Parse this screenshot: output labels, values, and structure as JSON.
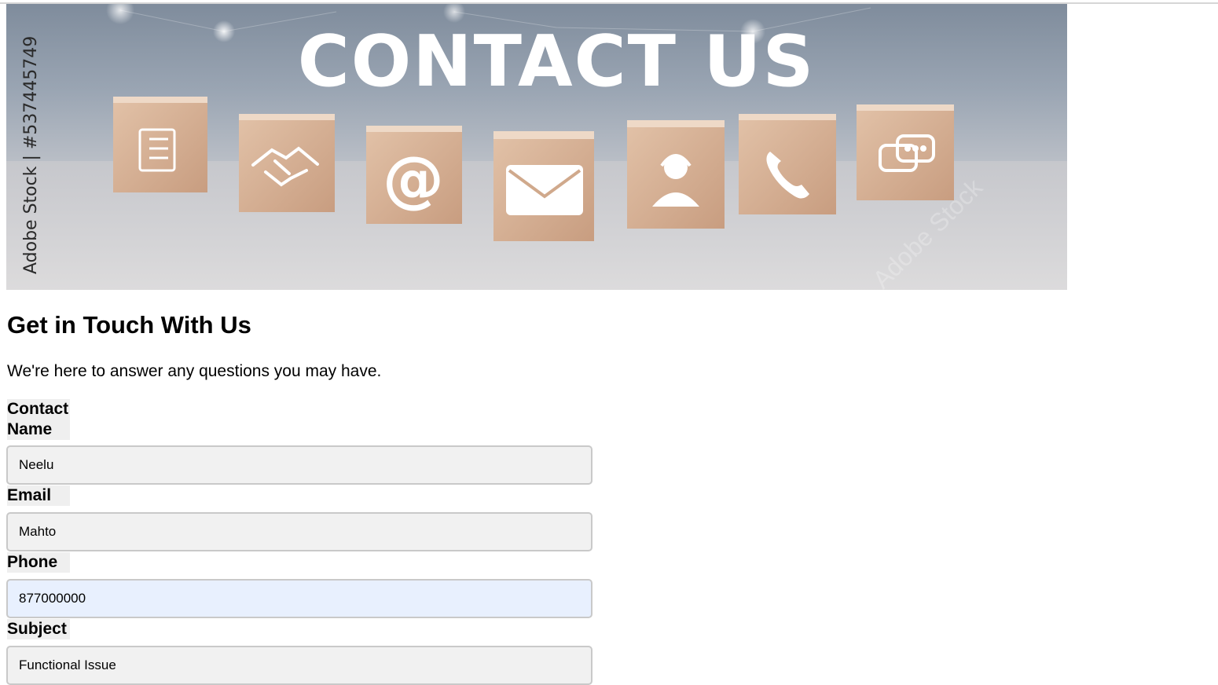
{
  "hero": {
    "title": "CONTACT US",
    "watermark": "Adobe Stock | #537445749",
    "stock_mark": "Adobe Stock",
    "cube_icons": [
      "checklist-icon",
      "handshake-icon",
      "at-sign-icon",
      "envelope-icon",
      "support-agent-icon",
      "phone-icon",
      "chat-bubbles-icon"
    ]
  },
  "page": {
    "heading": "Get in Touch With Us",
    "intro": "We're here to answer any questions you may have."
  },
  "form": {
    "contact_name_label": "Contact Name",
    "contact_name_value": "Neelu",
    "email_label": "Email",
    "email_value": "Mahto",
    "phone_label": "Phone",
    "phone_value": "877000000",
    "subject_label": "Subject",
    "subject_value": "Functional Issue"
  },
  "colors": {
    "input_background": "#f1f1f1",
    "input_autofill_background": "#e8f0fe",
    "input_border": "#c9c9c9",
    "label_background": "#efefef",
    "cube_wood": "#d9b59a"
  }
}
